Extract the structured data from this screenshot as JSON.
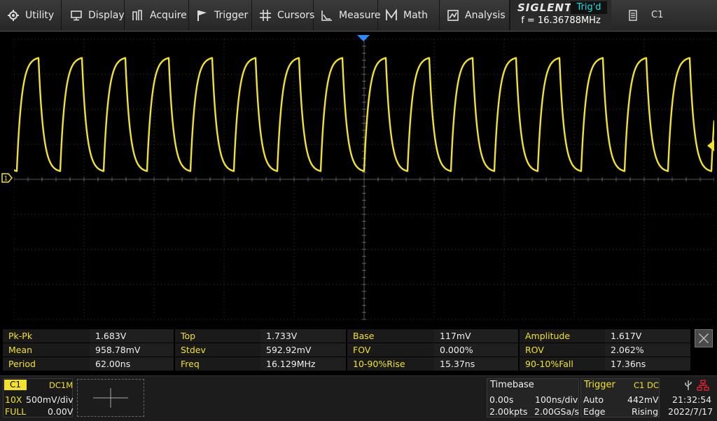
{
  "menu": {
    "items": [
      {
        "label": "Utility",
        "icon": "gear-icon"
      },
      {
        "label": "Display",
        "icon": "monitor-icon"
      },
      {
        "label": "Acquire",
        "icon": "acquire-icon"
      },
      {
        "label": "Trigger",
        "icon": "flag-icon"
      },
      {
        "label": "Cursors",
        "icon": "cursors-icon"
      },
      {
        "label": "Measure",
        "icon": "measure-icon"
      },
      {
        "label": "Math",
        "icon": "math-icon"
      },
      {
        "label": "Analysis",
        "icon": "analysis-icon"
      }
    ]
  },
  "brand": {
    "logo": "SIGLENT",
    "trig_status": "Trig'd",
    "frequency": "f = 16.36788MHz"
  },
  "channel_menu": {
    "label": "C1",
    "icon": "document-icon"
  },
  "colors": {
    "channel1": "#f2e22a",
    "trig_status": "#19e2e2",
    "trigger_marker": "#2a8cff"
  },
  "chart_data": {
    "type": "line",
    "series": [
      {
        "values": "periodic waveform, period 62.00ns, low 117mV, high 1.733V"
      }
    ],
    "period_ns": 62.0,
    "low_v": 0.117,
    "high_v": 1.733,
    "volts_per_div": 0.5,
    "ns_per_div": 100,
    "grid": true
  },
  "measure": {
    "rows": [
      [
        [
          "Pk-Pk",
          "1.683V"
        ],
        [
          "Top",
          "1.733V"
        ],
        [
          "Base",
          "117mV"
        ],
        [
          "Amplitude",
          "1.617V"
        ]
      ],
      [
        [
          "Mean",
          "958.78mV"
        ],
        [
          "Stdev",
          "592.92mV"
        ],
        [
          "FOV",
          "0.000%"
        ],
        [
          "ROV",
          "2.062%"
        ]
      ],
      [
        [
          "Period",
          "62.00ns"
        ],
        [
          "Freq",
          "16.129MHz"
        ],
        [
          "10-90%Rise",
          "15.37ns"
        ],
        [
          "90-10%Fall",
          "17.36ns"
        ]
      ]
    ]
  },
  "channel1": {
    "tag": "C1",
    "coupling": "DC1M",
    "probe": "10X",
    "scale": "500mV/div",
    "bandwidth": "FULL",
    "offset": "0.00V"
  },
  "timebase": {
    "title": "Timebase",
    "delay": "0.00s",
    "scale": "100ns/div",
    "memory": "2.00kpts",
    "sample_rate": "2.00GSa/s"
  },
  "trigger": {
    "title": "Trigger",
    "source": "C1 DC",
    "mode": "Auto",
    "level": "442mV",
    "type": "Edge",
    "slope": "Rising"
  },
  "status": {
    "time": "21:32:54",
    "date": "2022/7/17"
  }
}
